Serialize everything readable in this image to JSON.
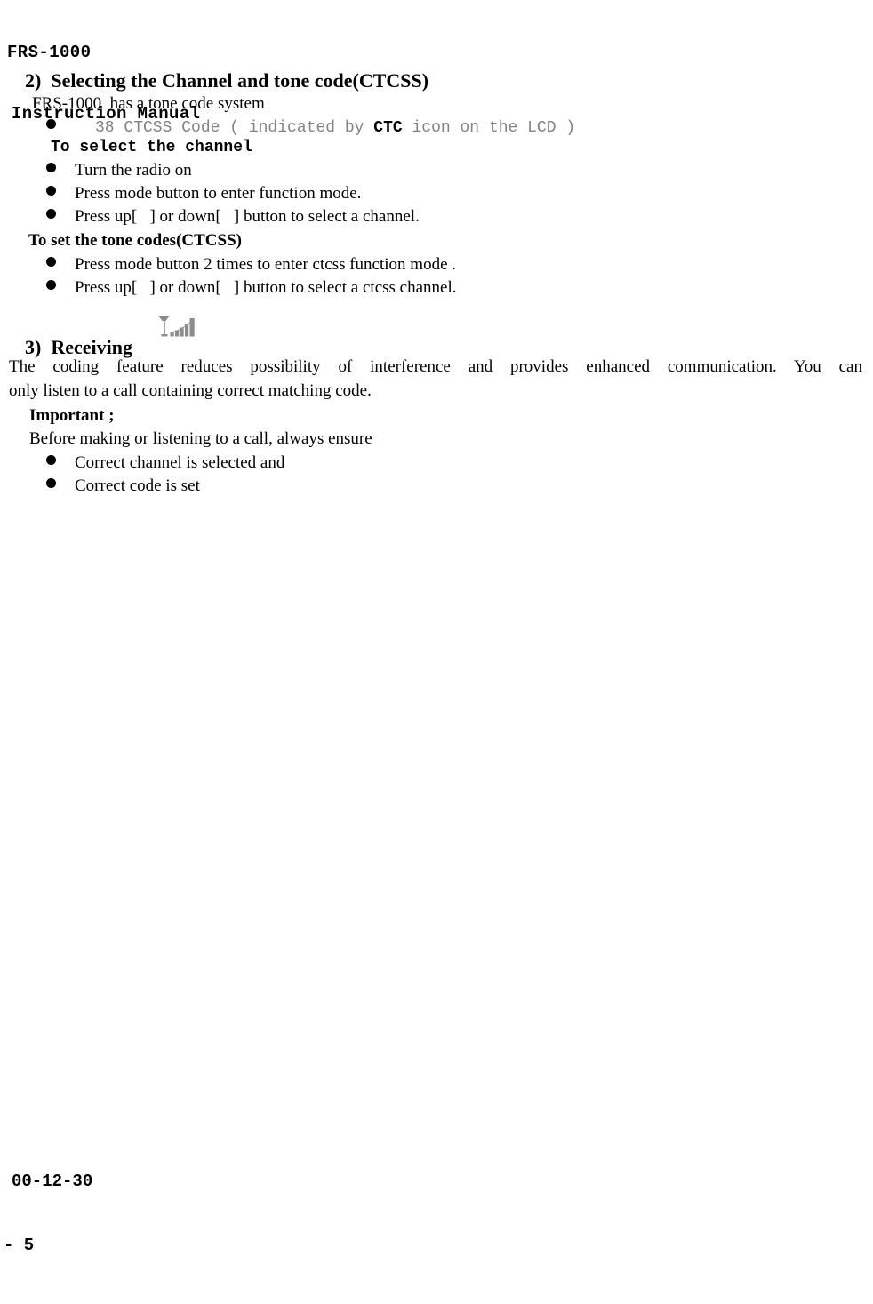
{
  "header": {
    "model": "FRS-1000",
    "doc_type": "Instruction Manual"
  },
  "sections": [
    {
      "number": "2)",
      "title": "Selecting the Channel and tone code(CTCSS)",
      "intro": "FRS-1000  has a tone code system",
      "ctcss_bullet": {
        "prefix": "38 CTCSS Code ( indicated by ",
        "emphasis": "CTC",
        "suffix": " icon on the LCD )"
      },
      "sub_heading_1": "To select the channel",
      "bullets_1": [
        "Turn the radio on",
        "Press mode button to enter function mode.",
        "Press up[   ] or down[   ] button to select a channel."
      ],
      "sub_heading_2": "To set the tone codes(CTCSS)",
      "bullets_2": [
        "Press mode button 2 times to enter ctcss function mode .",
        "Press up[   ] or down[   ] button to select a ctcss channel."
      ]
    },
    {
      "number": "3)",
      "title": "Receiving",
      "icon": "signal-strength-icon",
      "paragraph_line_1": "The coding feature reduces possibility of interference and provides enhanced communication. You can",
      "paragraph_line_2": "only listen to a call containing correct matching code.",
      "important_heading": "Important ;",
      "important_intro": "Before making or listening to a call, always ensure",
      "important_bullets": [
        "Correct channel is selected and",
        "Correct code is set"
      ]
    }
  ],
  "footer": {
    "date": "00-12-30",
    "page": "- 5"
  },
  "colors": {
    "text": "#000000",
    "mono_light": "#828282",
    "icon_gray": "#8c8c8c",
    "background": "#ffffff"
  }
}
